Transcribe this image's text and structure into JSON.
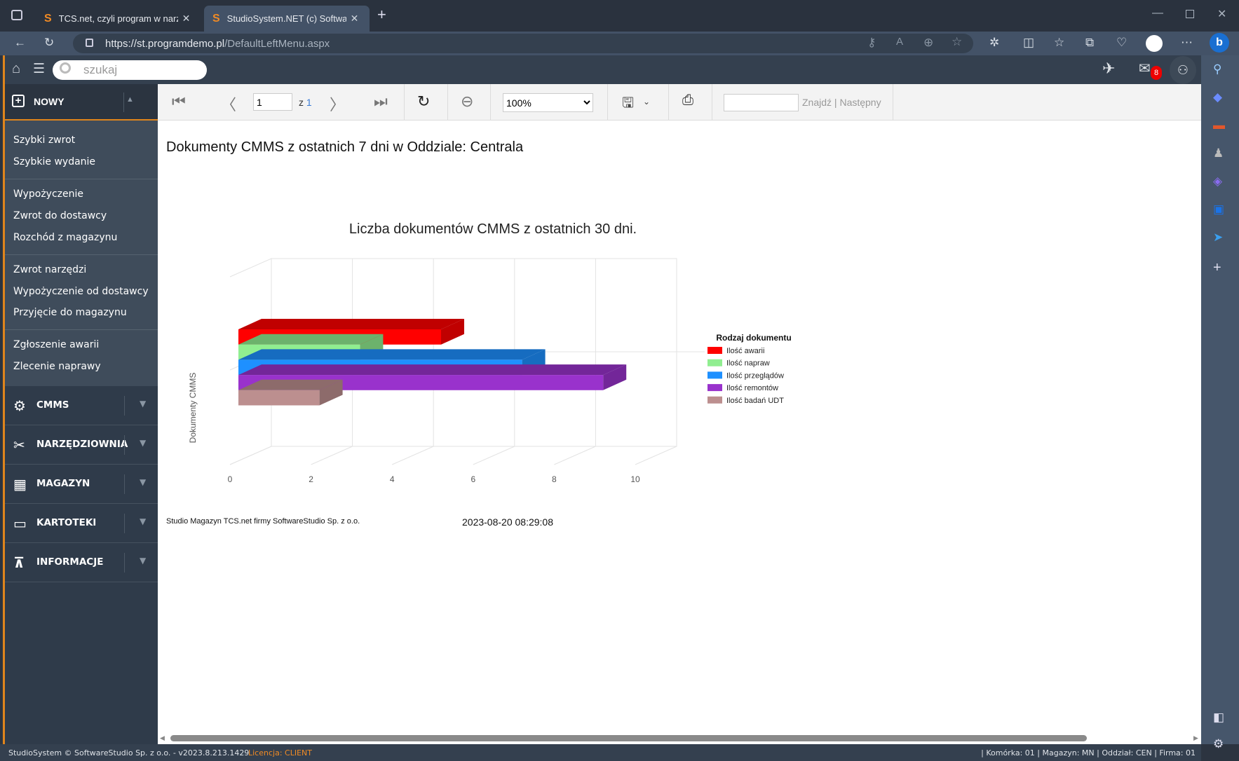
{
  "browser": {
    "tabs": [
      {
        "title": "TCS.net, czyli program w narzędziownia",
        "active": false
      },
      {
        "title": "StudioSystem.NET (c) SoftwareStudio",
        "active": true
      }
    ],
    "url_host": "https://st.programdemo.pl",
    "url_path": "/DefaultLeftMenu.aspx"
  },
  "app": {
    "search_placeholder": "szukaj",
    "mail_count": "8",
    "sidebar": {
      "nowy": "NOWY",
      "groups": [
        [
          "Szybki zwrot",
          "Szybkie wydanie"
        ],
        [
          "Wypożyczenie",
          "Zwrot do dostawcy",
          "Rozchód z magazynu"
        ],
        [
          "Zwrot narzędzi",
          "Wypożyczenie od dostawcy",
          "Przyjęcie do magazynu"
        ],
        [
          "Zgłoszenie awarii",
          "Zlecenie naprawy"
        ]
      ],
      "sections": [
        "CMMS",
        "NARZĘDZIOWNIA",
        "MAGAZYN",
        "KARTOTEKI",
        "INFORMACJE"
      ]
    },
    "toolbar": {
      "page": "1",
      "page_of": "z",
      "page_total": "1",
      "zoom": "100%",
      "find_label": "Znajdź",
      "next_label": "Następny",
      "find_sep": "|"
    },
    "report": {
      "title": "Dokumenty CMMS z ostatnich 7 dni w Oddziale: Centrala",
      "footer_left": "Studio Magazyn TCS.net firmy SoftwareStudio Sp. z o.o.",
      "footer_date": "2023-08-20 08:29:08"
    },
    "status": {
      "left": "StudioSystem © SoftwareStudio Sp. z o.o. - v2023.8.213.1429",
      "license": "Licencja: CLIENT",
      "right": "| Komórka: 01 | Magazyn: MN | Oddział: CEN | Firma: 01"
    }
  },
  "chart_data": {
    "type": "bar",
    "orientation": "horizontal-3d",
    "title": "Liczba dokumentów CMMS z ostatnich 30 dni.",
    "ylabel": "Dokumenty CMMS",
    "xlim": [
      0,
      10
    ],
    "xticks": [
      "0",
      "2",
      "4",
      "6",
      "8",
      "10"
    ],
    "legend_title": "Rodzaj dokumentu",
    "legend_position": "right",
    "series": [
      {
        "name": "Ilość awarii",
        "value": 5,
        "color": "#ff0000",
        "side": "#c00000"
      },
      {
        "name": "Ilość napraw",
        "value": 3,
        "color": "#90ee90",
        "side": "#6cb26c"
      },
      {
        "name": "Ilość przeglądów",
        "value": 7,
        "color": "#1e90ff",
        "side": "#166cc0"
      },
      {
        "name": "Ilość remontów",
        "value": 9,
        "color": "#9932cc",
        "side": "#732699"
      },
      {
        "name": "Ilość badań UDT",
        "value": 2,
        "color": "#bc8f8f",
        "side": "#8d6b6b"
      }
    ]
  }
}
